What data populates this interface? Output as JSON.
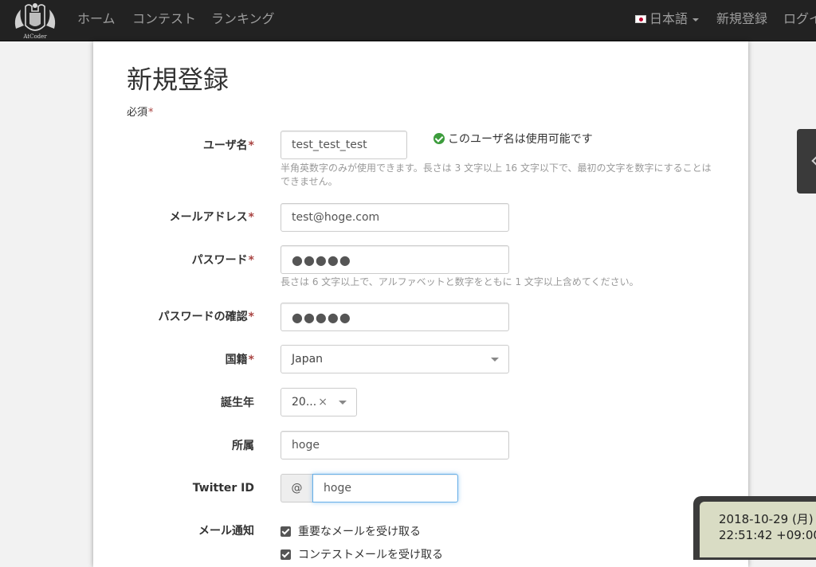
{
  "nav": {
    "logo_text": "AtCoder",
    "home": "ホーム",
    "contest": "コンテスト",
    "ranking": "ランキング",
    "language": "日本語",
    "signup": "新規登録",
    "login": "ログイ"
  },
  "form": {
    "title": "新規登録",
    "required_note": "必須",
    "required_mark": "*",
    "username": {
      "label": "ユーザ名",
      "value": "test_test_test",
      "availability": "このユーザ名は使用可能です",
      "help": "半角英数字のみが使用できます。長さは 3 文字以上 16 文字以下で、最初の文字を数字にすることはできません。"
    },
    "email": {
      "label": "メールアドレス",
      "value": "test@hoge.com"
    },
    "password": {
      "label": "パスワード",
      "value": "●●●●●",
      "help": "長さは 6 文字以上で、アルファベットと数字をともに 1 文字以上含めてください。"
    },
    "password_confirm": {
      "label": "パスワードの確認",
      "value": "●●●●●"
    },
    "country": {
      "label": "国籍",
      "value": "Japan"
    },
    "birth_year": {
      "label": "誕生年",
      "value": "20...",
      "clear": "×"
    },
    "affiliation": {
      "label": "所属",
      "value": "hoge"
    },
    "twitter": {
      "label": "Twitter ID",
      "prefix": "@",
      "value": "hoge"
    },
    "mail_notify": {
      "label": "メール通知",
      "option1": "重要なメールを受け取る",
      "option2": "コンテストメールを受け取る"
    }
  },
  "clock": {
    "date": "2018-10-29 (月)",
    "time": "22:51:42 +09:00"
  },
  "colors": {
    "navbar": "#222222",
    "required": "#a94442",
    "check_green": "#3c9c3c",
    "focus_border": "#66afe9"
  }
}
